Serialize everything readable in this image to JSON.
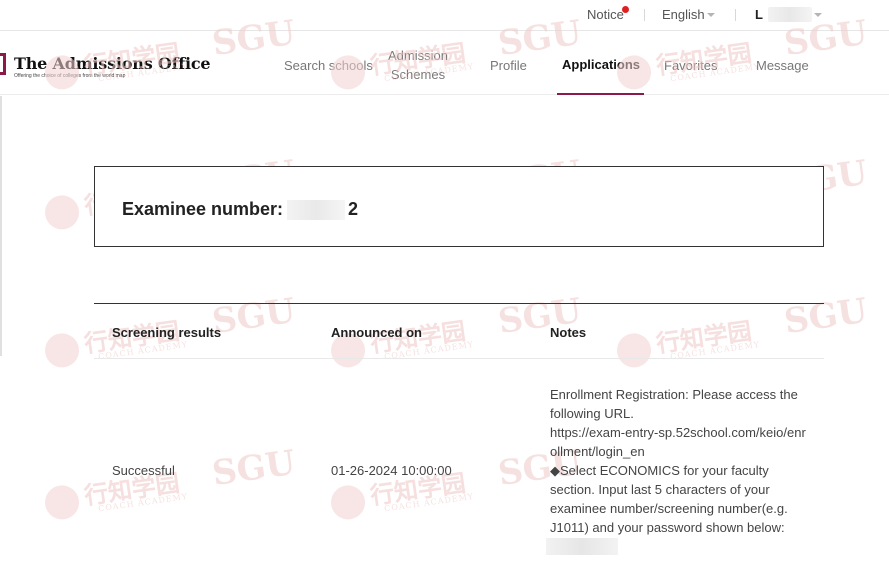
{
  "topbar": {
    "notice": "Notice",
    "language": "English",
    "user_initial": "L"
  },
  "brand": {
    "name": "The Admissions Office",
    "tagline": "Offering the choice of colleges from the world map"
  },
  "nav": {
    "search_schools": "Search schools",
    "admission_line1": "Admission",
    "admission_line2": "Schemes",
    "profile": "Profile",
    "applications": "Applications",
    "favorites": "Favorites",
    "message": "Message"
  },
  "examinee": {
    "label": "Examinee number:",
    "number_tail": "2"
  },
  "results": {
    "headers": {
      "screening": "Screening results",
      "announced": "Announced on",
      "notes": "Notes"
    },
    "row": {
      "screening": "Successful",
      "announced": "01-26-2024 10:00:00",
      "notes_line1": "Enrollment Registration: Please access the following URL.",
      "notes_url": "https://exam-entry-sp.52school.com/keio/enrollment/login_en",
      "notes_line2": "◆Select ECONOMICS for your faculty section. Input last 5 characters of your examinee number/screening number(e.g. J1011) and your password shown below:"
    }
  },
  "watermark": {
    "chinese": "行知学园",
    "latin": "SGU",
    "academy": "COACH ACADEMY"
  },
  "colors": {
    "accent": "#8b1a4a",
    "notice_dot": "#e02020",
    "watermark": "#efc5c5"
  }
}
